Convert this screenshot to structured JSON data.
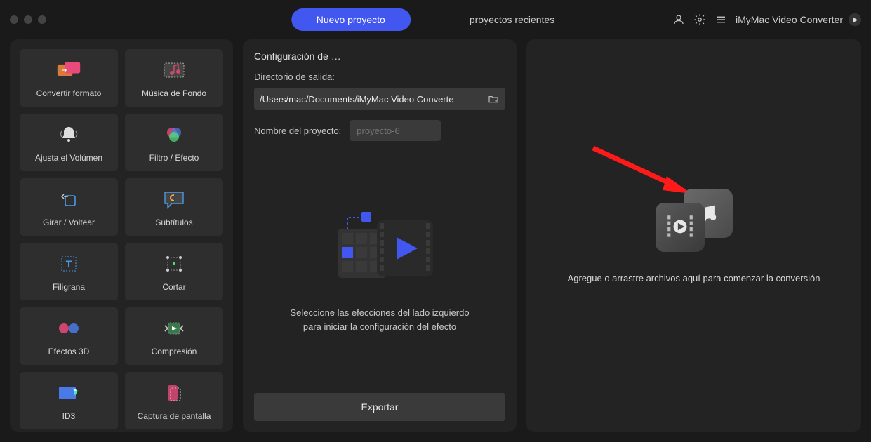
{
  "header": {
    "tab_new": "Nuevo proyecto",
    "tab_recent": "proyectos recientes",
    "app_name": "iMyMac Video Converter"
  },
  "sidebar": {
    "tools": [
      {
        "id": "convert-format",
        "label": "Convertir formato"
      },
      {
        "id": "background-music",
        "label": "Música de Fondo"
      },
      {
        "id": "adjust-volume",
        "label": "Ajusta el Volúmen"
      },
      {
        "id": "filter-effect",
        "label": "Filtro / Efecto"
      },
      {
        "id": "rotate-flip",
        "label": "Girar / Voltear"
      },
      {
        "id": "subtitles",
        "label": "Subtítulos"
      },
      {
        "id": "watermark",
        "label": "Filigrana"
      },
      {
        "id": "cut",
        "label": "Cortar"
      },
      {
        "id": "3d-effects",
        "label": "Efectos 3D"
      },
      {
        "id": "compression",
        "label": "Compresión"
      },
      {
        "id": "id3",
        "label": "ID3"
      },
      {
        "id": "screenshot",
        "label": "Captura de pantalla"
      }
    ]
  },
  "center": {
    "title": "Configuración de …",
    "output_dir_label": "Directorio de salida:",
    "output_dir_value": "/Users/mac/Documents/iMyMac Video Converte",
    "project_name_label": "Nombre del proyecto:",
    "project_name_placeholder": "proyecto-6",
    "hint_line1": "Seleccione las efecciones del lado izquierdo",
    "hint_line2": "para iniciar la configuración del efecto",
    "export_label": "Exportar"
  },
  "right": {
    "drop_text": "Agregue o arrastre archivos aquí para comenzar la conversión"
  }
}
